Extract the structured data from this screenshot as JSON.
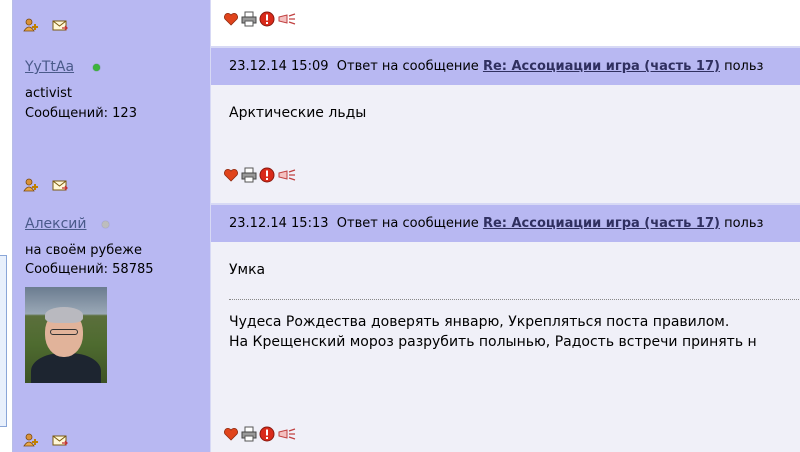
{
  "posts": [
    {
      "username": "YyTtAa",
      "status": "online",
      "rank": "activist",
      "messages_count": "Сообщений: 123",
      "datetime": "23.12.14 15:09",
      "reply_prefix": "Ответ на сообщение",
      "reply_link": "Re: Ассоциации игра (часть 17)",
      "reply_suffix": "польз",
      "body": [
        "Арктические льды"
      ]
    },
    {
      "username": "Алексий",
      "status": "offline",
      "rank": "на своём рубеже",
      "messages_count": "Сообщений: 58785",
      "datetime": "23.12.14 15:13",
      "reply_prefix": "Ответ на сообщение",
      "reply_link": "Re: Ассоциации игра (часть 17)",
      "reply_suffix": "польз",
      "body": [
        "Умка"
      ],
      "signature": [
        "Чудеса Рождества доверять январю, Укрепляться поста правилом.",
        "На Крещенский мороз разрубить полынью, Радость встречи принять н"
      ]
    }
  ],
  "icons": {
    "user": [
      "add-friend-icon",
      "send-message-icon"
    ],
    "message": [
      "like-heart-icon",
      "print-icon",
      "report-icon",
      "share-icon"
    ]
  },
  "colors": {
    "user_panel": "#b8b8f2",
    "message_body": "#f0f0f8",
    "online": "#3db43d",
    "offline": "#bdbdbd"
  }
}
